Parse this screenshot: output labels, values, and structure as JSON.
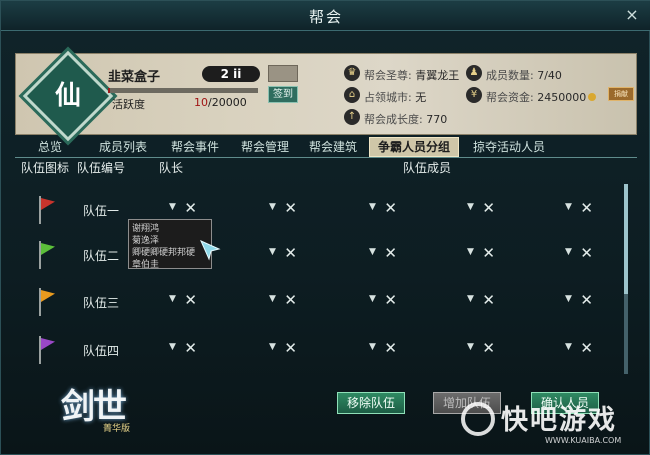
{
  "window": {
    "title": "帮会",
    "close_label": "×"
  },
  "guild": {
    "emblem_char": "仙",
    "name": "韭菜盒子",
    "rank": "2 ii",
    "btn_disabled_label": "",
    "signin_label": "签到",
    "activity_label": "活跃度",
    "activity_current": "10",
    "activity_total": "/20000",
    "activity_fraction": 0.0005
  },
  "stats": {
    "leader_label": "帮会圣尊:",
    "leader_value": "青翼龙王",
    "city_label": "占领城市:",
    "city_value": "无",
    "growth_label": "帮会成长度:",
    "growth_value": "770",
    "members_label": "成员数量:",
    "members_value": "7/40",
    "funds_label": "帮会资金:",
    "funds_value": "2450000",
    "donate_label": "捐献"
  },
  "tabs": [
    "总览",
    "成员列表",
    "帮会事件",
    "帮会管理",
    "帮会建筑",
    "争霸人员分组",
    "掠夺活动人员"
  ],
  "active_tab": "争霸人员分组",
  "table_headers": {
    "icon": "队伍图标",
    "number": "队伍编号",
    "leader": "队长",
    "members": "队伍成员"
  },
  "teams": [
    {
      "name": "队伍一",
      "flag_color": "#c8342c"
    },
    {
      "name": "队伍二",
      "flag_color": "#5cbf3a"
    },
    {
      "name": "队伍三",
      "flag_color": "#e89a1e"
    },
    {
      "name": "队伍四",
      "flag_color": "#9a48c6"
    }
  ],
  "dropdown_options": [
    "谢翔鸿",
    "菊逸泽",
    "卿硬卿硬邦邦硬",
    "章伯圭"
  ],
  "buttons": {
    "remove": "移除队伍",
    "add": "增加队伍",
    "confirm": "确认人员"
  },
  "logo": {
    "title": "剑世",
    "subtitle": "菁华版"
  },
  "watermark": {
    "text": "快吧游戏",
    "url": "WWW.KUAIBA.COM"
  }
}
